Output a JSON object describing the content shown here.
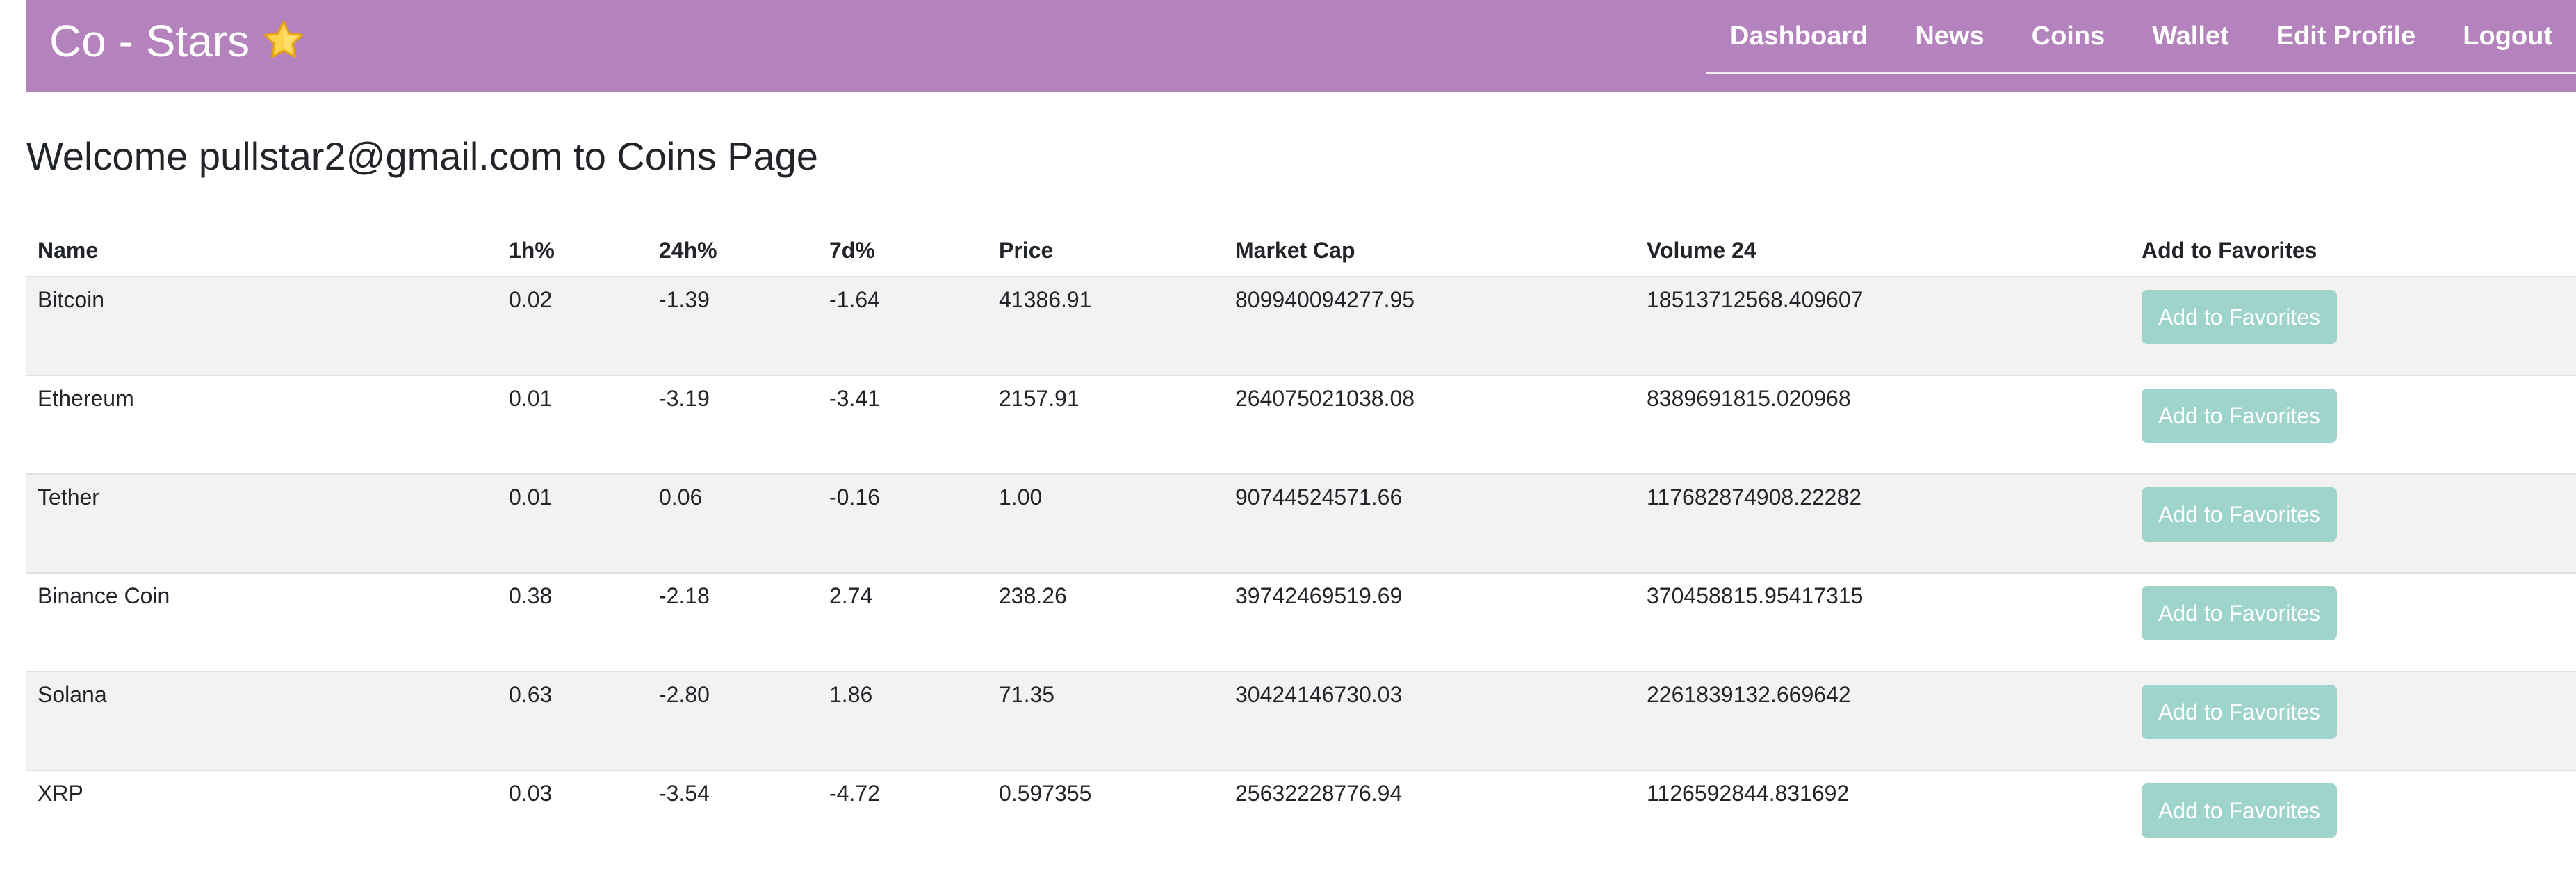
{
  "navbar": {
    "brand": "Co - Stars",
    "brand_icon": "star-icon",
    "colors": {
      "background": "#b482bc",
      "text": "#ffffff"
    },
    "links": [
      "Dashboard",
      "News",
      "Coins",
      "Wallet",
      "Edit Profile",
      "Logout"
    ]
  },
  "page": {
    "heading": "Welcome pullstar2@gmail.com to Coins Page"
  },
  "table": {
    "headers": [
      "Name",
      "1h%",
      "24h%",
      "7d%",
      "Price",
      "Market Cap",
      "Volume 24",
      "Add to Favorites"
    ],
    "button_label": "Add to Favorites",
    "button_color": "#9ed4cb",
    "rows": [
      {
        "name": "Bitcoin",
        "h1": "0.02",
        "h24": "-1.39",
        "d7": "-1.64",
        "price": "41386.91",
        "market_cap": "809940094277.95",
        "volume": "18513712568.409607"
      },
      {
        "name": "Ethereum",
        "h1": "0.01",
        "h24": "-3.19",
        "d7": "-3.41",
        "price": "2157.91",
        "market_cap": "264075021038.08",
        "volume": "8389691815.020968"
      },
      {
        "name": "Tether",
        "h1": "0.01",
        "h24": "0.06",
        "d7": "-0.16",
        "price": "1.00",
        "market_cap": "90744524571.66",
        "volume": "117682874908.22282"
      },
      {
        "name": "Binance Coin",
        "h1": "0.38",
        "h24": "-2.18",
        "d7": "2.74",
        "price": "238.26",
        "market_cap": "39742469519.69",
        "volume": "370458815.95417315"
      },
      {
        "name": "Solana",
        "h1": "0.63",
        "h24": "-2.80",
        "d7": "1.86",
        "price": "71.35",
        "market_cap": "30424146730.03",
        "volume": "2261839132.669642"
      },
      {
        "name": "XRP",
        "h1": "0.03",
        "h24": "-3.54",
        "d7": "-4.72",
        "price": "0.597355",
        "market_cap": "25632228776.94",
        "volume": "1126592844.831692"
      }
    ]
  }
}
